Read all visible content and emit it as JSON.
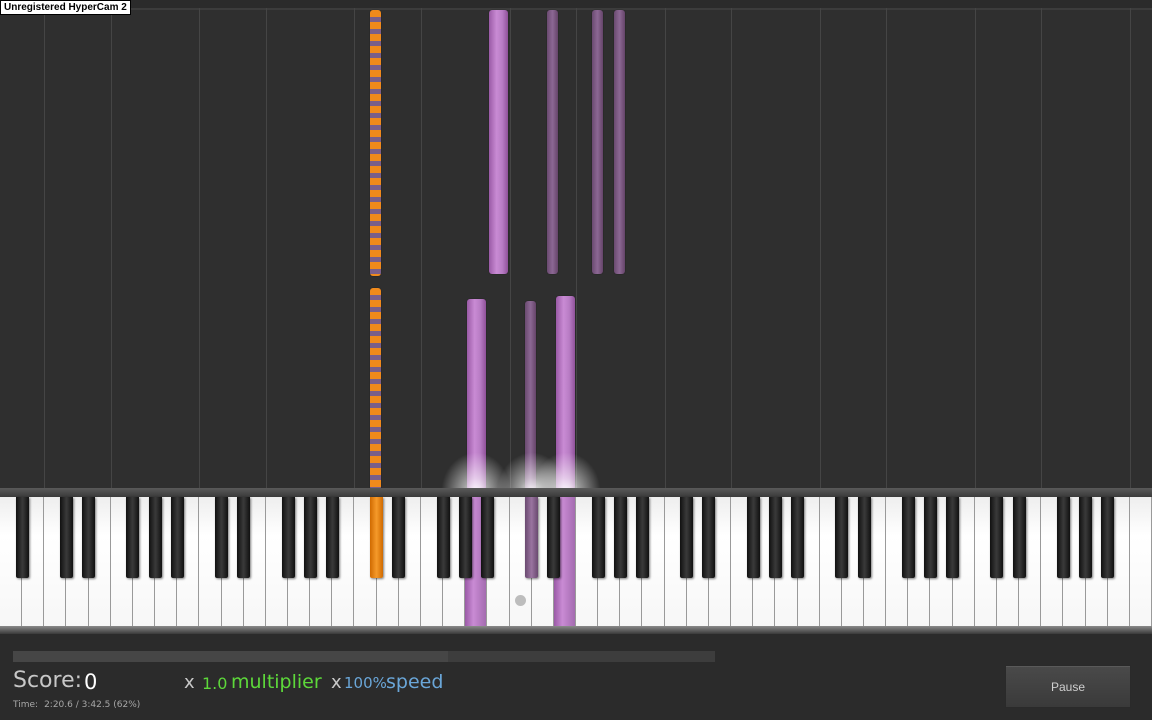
{
  "watermark": "Unregistered HyperCam 2",
  "score": {
    "label": "Score:",
    "value": "0"
  },
  "multiplier": {
    "x": "x",
    "value": "1.0",
    "label": "multiplier"
  },
  "speed": {
    "x": "x",
    "value": "100%",
    "label": "speed"
  },
  "time": {
    "label": "Time:",
    "value": "2:20.6 / 3:42.5 (62%)"
  },
  "progress_fraction": 0.62,
  "pause_button": "Pause",
  "colors": {
    "note_purple": "#c98bd4",
    "note_orange": "#f08a1c",
    "multiplier_green": "#5dd83a",
    "speed_blue": "#6aa6d8",
    "keyboard_red_line": "#a01818"
  }
}
